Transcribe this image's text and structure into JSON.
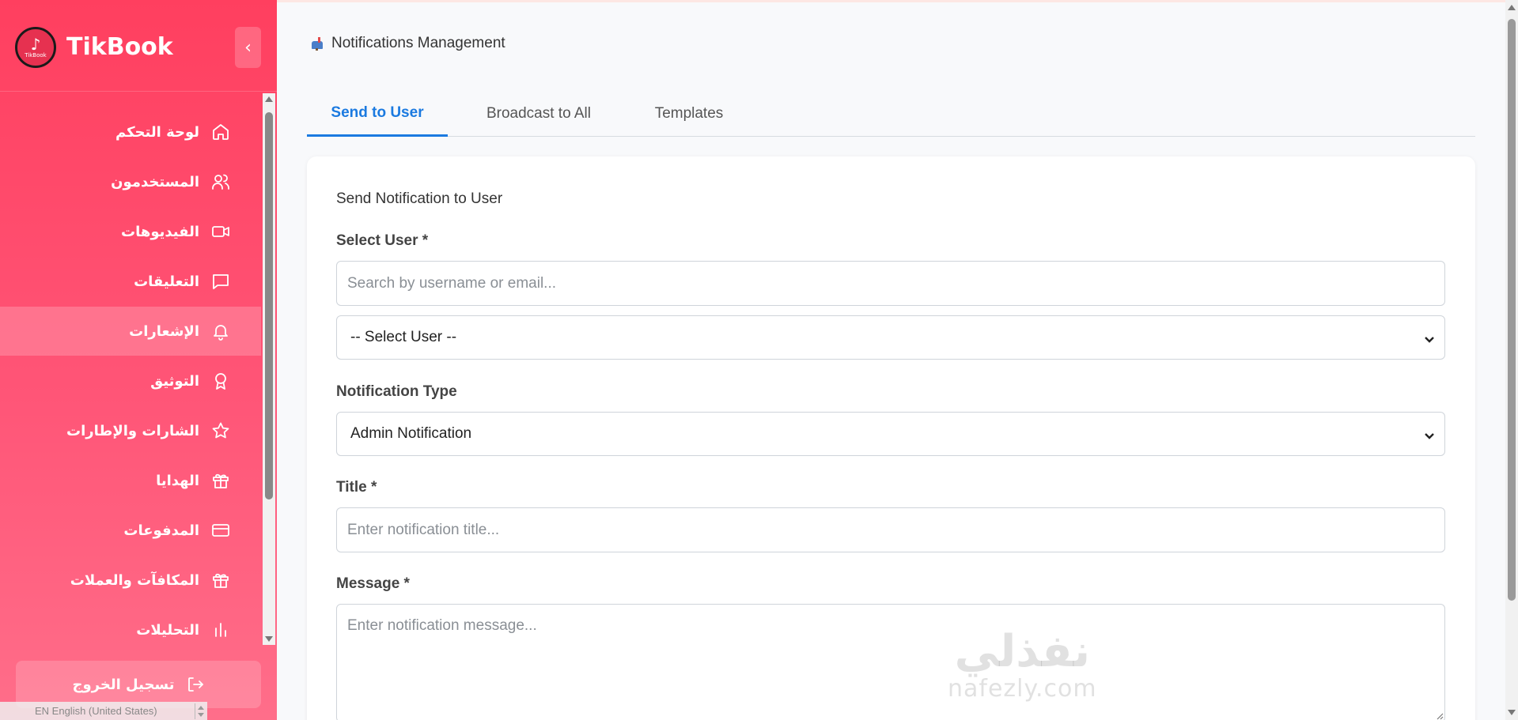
{
  "app": {
    "brand": "TikBook",
    "logo_text": "TikBook",
    "logo_icon": "music-note-icon"
  },
  "sidebar": {
    "items": [
      {
        "label": "لوحة التحكم",
        "icon": "home-icon",
        "active": false
      },
      {
        "label": "المستخدمون",
        "icon": "users-icon",
        "active": false
      },
      {
        "label": "الفيديوهات",
        "icon": "video-icon",
        "active": false
      },
      {
        "label": "التعليقات",
        "icon": "comment-icon",
        "active": false
      },
      {
        "label": "الإشعارات",
        "icon": "bell-icon",
        "active": true
      },
      {
        "label": "التوثيق",
        "icon": "award-icon",
        "active": false
      },
      {
        "label": "الشارات والإطارات",
        "icon": "star-icon",
        "active": false
      },
      {
        "label": "الهدايا",
        "icon": "gift-icon",
        "active": false
      },
      {
        "label": "المدفوعات",
        "icon": "credit-card-icon",
        "active": false
      },
      {
        "label": "المكافآت والعملات",
        "icon": "gift-icon",
        "active": false
      },
      {
        "label": "التحليلات",
        "icon": "bar-chart-icon",
        "active": false
      }
    ],
    "logout_label": "تسجيل الخروج",
    "language": "EN English (United States)"
  },
  "page": {
    "title": "Notifications Management",
    "tabs": [
      {
        "label": "Send to User",
        "active": true
      },
      {
        "label": "Broadcast to All",
        "active": false
      },
      {
        "label": "Templates",
        "active": false
      }
    ]
  },
  "form": {
    "card_title": "Send Notification to User",
    "select_user_label": "Select User *",
    "search_placeholder": "Search by username or email...",
    "select_user_value": "-- Select User --",
    "type_label": "Notification Type",
    "type_value": "Admin Notification",
    "title_label": "Title *",
    "title_placeholder": "Enter notification title...",
    "message_label": "Message *",
    "message_placeholder": "Enter notification message..."
  },
  "watermark": {
    "arabic": "نفذلي",
    "latin": "nafezly.com"
  },
  "colors": {
    "sidebar_start": "#ff3f5f",
    "sidebar_end": "#ff6e8a",
    "accent": "#1b7ae0"
  }
}
